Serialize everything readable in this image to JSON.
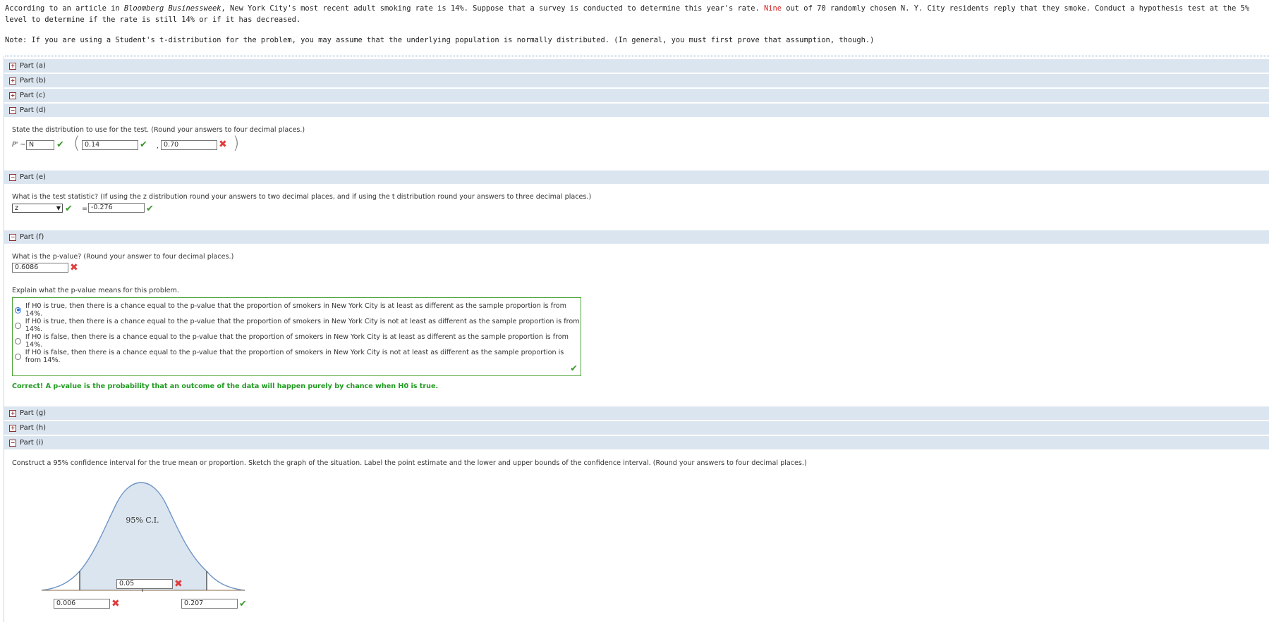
{
  "intro": {
    "p1": "According to an article in ",
    "source": "Bloomberg Businessweek",
    "p2": ", New York City's most recent adult smoking rate is 14%. Suppose that a survey is conducted to determine this year's rate. ",
    "nine": "Nine",
    "p3": " out of 70 randomly chosen N. Y. City residents reply that they smoke. Conduct a hypothesis test at the 5% level to determine if the rate is still 14% or if it has decreased.",
    "note": "Note: If you are using a Student's t-distribution for the problem, you may assume that the underlying population is normally distributed. (In general, you must first prove that assumption, though.)"
  },
  "parts": {
    "a": "Part (a)",
    "b": "Part (b)",
    "c": "Part (c)",
    "d": "Part (d)",
    "e": "Part (e)",
    "f": "Part (f)",
    "g": "Part (g)",
    "h": "Part (h)",
    "i": "Part (i)"
  },
  "part_d": {
    "question": "State the distribution to use for the test. (Round your answers to four decimal places.)",
    "prefix": "P' ~",
    "dist": "N",
    "mean": "0.14",
    "sd": "0.70"
  },
  "part_e": {
    "question": "What is the test statistic? (If using the z distribution round your answers to two decimal places, and if using the t distribution round your answers to three decimal places.)",
    "stat_type": "z",
    "equals": "=",
    "value": "-0.276"
  },
  "part_f": {
    "question": "What is the p-value? (Round your answer to four decimal places.)",
    "pvalue": "0.6086",
    "explain": "Explain what the p-value means for this problem.",
    "choices": [
      "If H0 is true, then there is a chance equal to the p-value that the proportion of smokers in New York City is at least as different as the sample proportion is from 14%.",
      "If H0 is true, then there is a chance equal to the p-value that the proportion of smokers in New York City is not at least as different as the sample proportion is from 14%.",
      "If H0 is false, then there is a chance equal to the p-value that the proportion of smokers in New York City is at least as different as the sample proportion is from 14%.",
      "If H0 is false, then there is a chance equal to the p-value that the proportion of smokers in New York City is not at least as different as the sample proportion is from 14%."
    ],
    "selected_index": 0,
    "feedback": "Correct! A p-value is the probability that an outcome of the data will happen purely by chance when  H0  is true."
  },
  "part_i": {
    "question": "Construct a 95% confidence interval for the true mean or proportion. Sketch the graph of the situation. Label the point estimate and the lower and upper bounds of the confidence interval. (Round your answers to four decimal places.)",
    "ci_label": "95% C.I.",
    "point_estimate": "0.05",
    "lower": "0.006",
    "upper": "0.207"
  },
  "colors": {
    "bar": "#dbe5ef",
    "correct": "#3a9a2a",
    "wrong": "#e03c3c",
    "curve": "#6f95c6"
  }
}
